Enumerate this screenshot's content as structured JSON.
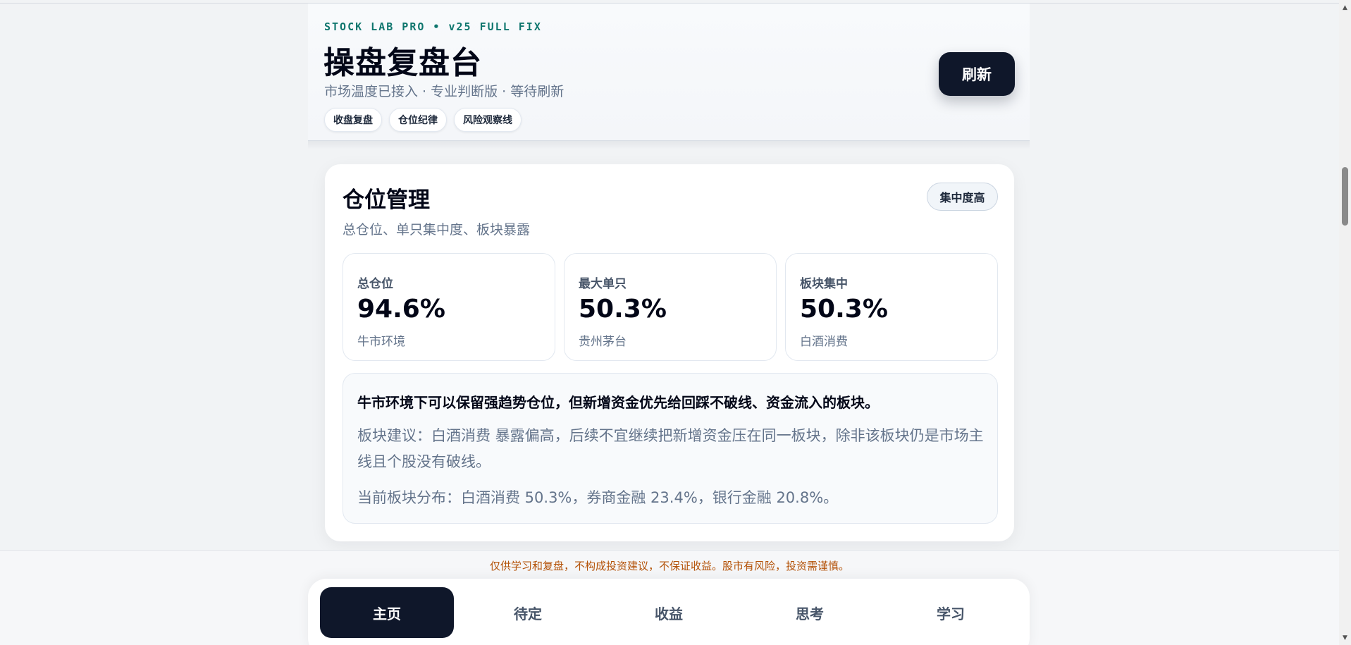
{
  "header": {
    "eyebrow": "STOCK LAB PRO • v25 FULL FIX",
    "title": "操盘复盘台",
    "subtitle": "市场温度已接入 · 专业判断版 · 等待刷新",
    "chips": [
      "收盘复盘",
      "仓位纪律",
      "风险观察线"
    ],
    "refresh_label": "刷新"
  },
  "position_card": {
    "title": "仓位管理",
    "subtitle": "总仓位、单只集中度、板块暴露",
    "badge": "集中度高",
    "stats": [
      {
        "label": "总仓位",
        "value": "94.6%",
        "note": "牛市环境"
      },
      {
        "label": "最大单只",
        "value": "50.3%",
        "note": "贵州茅台"
      },
      {
        "label": "板块集中",
        "value": "50.3%",
        "note": "白酒消费"
      }
    ],
    "advice_head": "牛市环境下可以保留强趋势仓位，但新增资金优先给回踩不破线、资金流入的板块。",
    "advice_body": "板块建议：白酒消费 暴露偏高，后续不宜继续把新增资金压在同一板块，除非该板块仍是市场主线且个股没有破线。",
    "distribution": "当前板块分布：白酒消费 50.3%，券商金融 23.4%，银行金融 20.8%。"
  },
  "disclaimer": "仅供学习和复盘，不构成投资建议，不保证收益。股市有风险，投资需谨慎。",
  "nav": {
    "items": [
      "主页",
      "待定",
      "收益",
      "思考",
      "学习"
    ],
    "active": "主页"
  },
  "colors": {
    "accent_teal": "#0f766e",
    "dark": "#0f172a",
    "warning": "#b45309"
  }
}
